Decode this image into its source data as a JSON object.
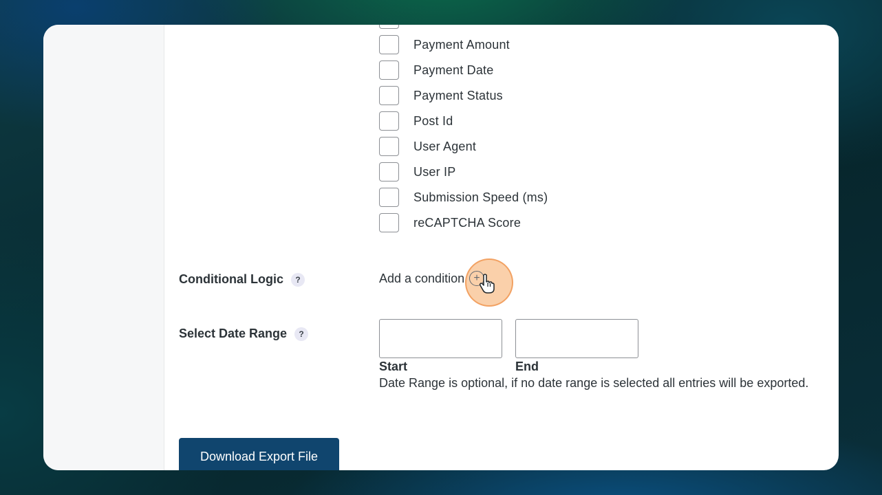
{
  "checkbox_fields": [
    {
      "label": "Payment Amount",
      "checked": false
    },
    {
      "label": "Payment Date",
      "checked": false
    },
    {
      "label": "Payment Status",
      "checked": false
    },
    {
      "label": "Post Id",
      "checked": false
    },
    {
      "label": "User Agent",
      "checked": false
    },
    {
      "label": "User IP",
      "checked": false
    },
    {
      "label": "Submission Speed (ms)",
      "checked": false
    },
    {
      "label": "reCAPTCHA Score",
      "checked": false
    }
  ],
  "conditional_logic": {
    "label": "Conditional Logic",
    "help": "?",
    "add_condition": "Add a condition",
    "add_icon": "+"
  },
  "date_range": {
    "label": "Select Date Range",
    "help": "?",
    "start_value": "",
    "end_value": "",
    "start_label": "Start",
    "end_label": "End",
    "note": "Date Range is optional, if no date range is selected all entries will be exported."
  },
  "download_button": "Download Export File",
  "colors": {
    "button": "#10456e",
    "click_highlight": "#f5aa64"
  }
}
